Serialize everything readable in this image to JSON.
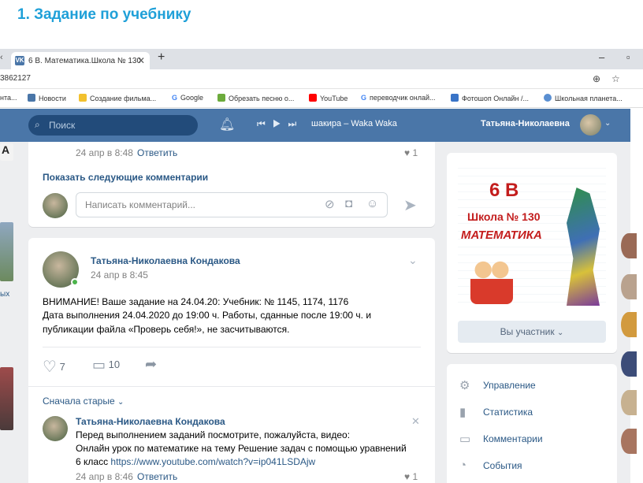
{
  "slide": {
    "title": "1.  Задание по учебнику"
  },
  "browser": {
    "tab_title": "6 В. Математика.Школа № 130",
    "url": "3862127",
    "bookmarks": [
      "нта...",
      "Новости",
      "Создание фильма...",
      "Google",
      "Обрезать песню о...",
      "YouTube",
      "переводчик онлай...",
      "Фотошоп Онлайн /...",
      "Школьная планета..."
    ]
  },
  "vk": {
    "search_placeholder": "Поиск",
    "now_playing": "шакира – Waka Waka",
    "user_name": "Татьяна-Николаевна"
  },
  "top_card": {
    "comment_date": "24 апр в 8:48",
    "reply": "Ответить",
    "likes": "1",
    "show_more": "Показать следующие комментарии",
    "comment_placeholder": "Написать комментарий..."
  },
  "post": {
    "author": "Татьяна-Николаевна Кондакова",
    "date": "24 апр в 8:45",
    "line1": "ВНИМАНИЕ! Ваше задание на 24.04.20: Учебник: № 1145, 1174, 1176",
    "line2": "Дата выполнения 24.04.2020 до 19:00 ч. Работы, сданные после 19:00 ч. и",
    "line3": "публикации файла «Проверь себя!», не засчитываются.",
    "likes": "7",
    "comments": "10",
    "sort": "Сначала старые",
    "comment": {
      "author": "Татьяна-Николаевна Кондакова",
      "line1": "Перед выполнением заданий посмотрите, пожалуйста, видео:",
      "line2": "Онлайн урок по математике на тему Решение задач с помощью уравнений",
      "line3": "6 класс ",
      "link": "https://www.youtube.com/watch?v=ip041LSDAjw",
      "date_cut": "24 апр в 8:46",
      "reply_cut": "Ответить",
      "likes_cut": "1"
    }
  },
  "community": {
    "cover_line1": "6 В",
    "cover_line2": "Школа № 130",
    "cover_line3": "МАТЕМАТИКА",
    "member_button": "Вы участник",
    "menu": [
      "Управление",
      "Статистика",
      "Комментарии",
      "События"
    ]
  },
  "left_strip": {
    "label_a": "A",
    "label_ykh": "ых"
  },
  "colors": {
    "vk_blue": "#4a76a8",
    "title_blue": "#1fa0d8",
    "link": "#2a5885"
  }
}
